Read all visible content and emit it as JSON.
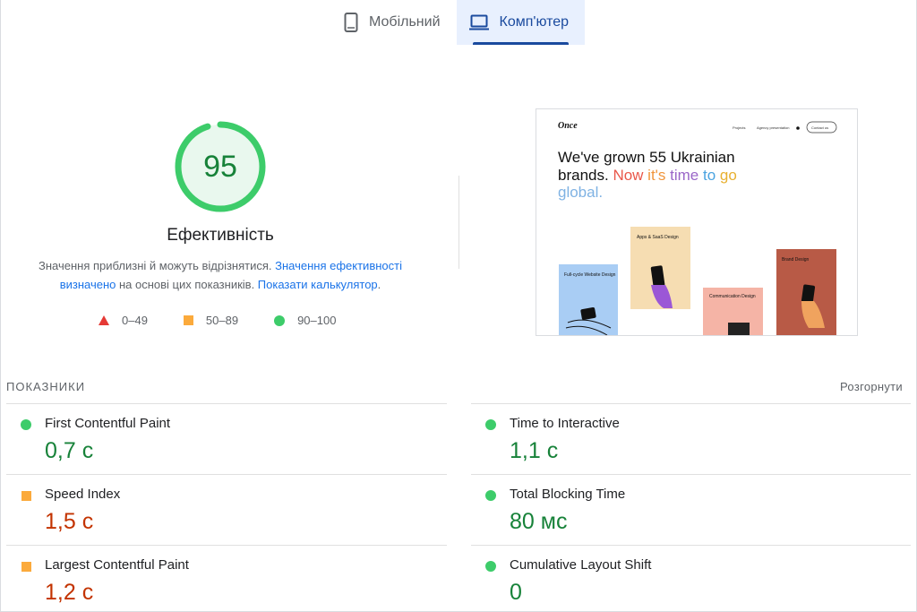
{
  "tabs": [
    {
      "label": "Мобільний",
      "icon": "smartphone-icon",
      "active": false
    },
    {
      "label": "Комп'ютер",
      "icon": "laptop-icon",
      "active": true
    }
  ],
  "score": {
    "value": "95",
    "fraction": 0.95,
    "title": "Ефективність",
    "color": "#3dcc6a"
  },
  "description": {
    "text1": "Значення приблизні й можуть відрізнятися. ",
    "link1": "Значення ефективності визначено",
    "text2": " на основі цих показників. ",
    "link2": "Показати калькулятор",
    "text3": "."
  },
  "legend": [
    {
      "range": "0–49",
      "shape": "triangle",
      "color": "#e53935"
    },
    {
      "range": "50–89",
      "shape": "square",
      "color": "#fbaa3c"
    },
    {
      "range": "90–100",
      "shape": "circle",
      "color": "#3dcc6a"
    }
  ],
  "screenshot": {
    "logo": "Once",
    "nav": [
      "Projects",
      "Agency presentation"
    ],
    "cta": "Contact us",
    "headline_line1": "We've grown 55 Ukrainian",
    "headline_line2a": "brands. ",
    "headline_now": "Now",
    "headline_its": " it's",
    "headline_time": " time",
    "headline_to": " to",
    "headline_go": " go",
    "headline_line3": "global.",
    "cards": [
      {
        "label": "Full-cycle Website Design"
      },
      {
        "label": "Apps & SaaS Design"
      },
      {
        "label": "Communication Design"
      },
      {
        "label": "Brand Design"
      }
    ]
  },
  "metrics_section": {
    "title": "ПОКАЗНИКИ",
    "expand": "Розгорнути"
  },
  "metrics": [
    {
      "label": "First Contentful Paint",
      "value": "0,7 с",
      "status": "good"
    },
    {
      "label": "Time to Interactive",
      "value": "1,1 с",
      "status": "good"
    },
    {
      "label": "Speed Index",
      "value": "1,5 с",
      "status": "average"
    },
    {
      "label": "Total Blocking Time",
      "value": "80 мс",
      "status": "good"
    },
    {
      "label": "Largest Contentful Paint",
      "value": "1,2 с",
      "status": "average"
    },
    {
      "label": "Cumulative Layout Shift",
      "value": "0",
      "status": "good"
    }
  ],
  "colors": {
    "good": "#3dcc6a",
    "good_text": "#178239",
    "average": "#fbaa3c",
    "average_text": "#c33300",
    "link": "#1a73e8",
    "tab_active": "#1a4a9e"
  }
}
